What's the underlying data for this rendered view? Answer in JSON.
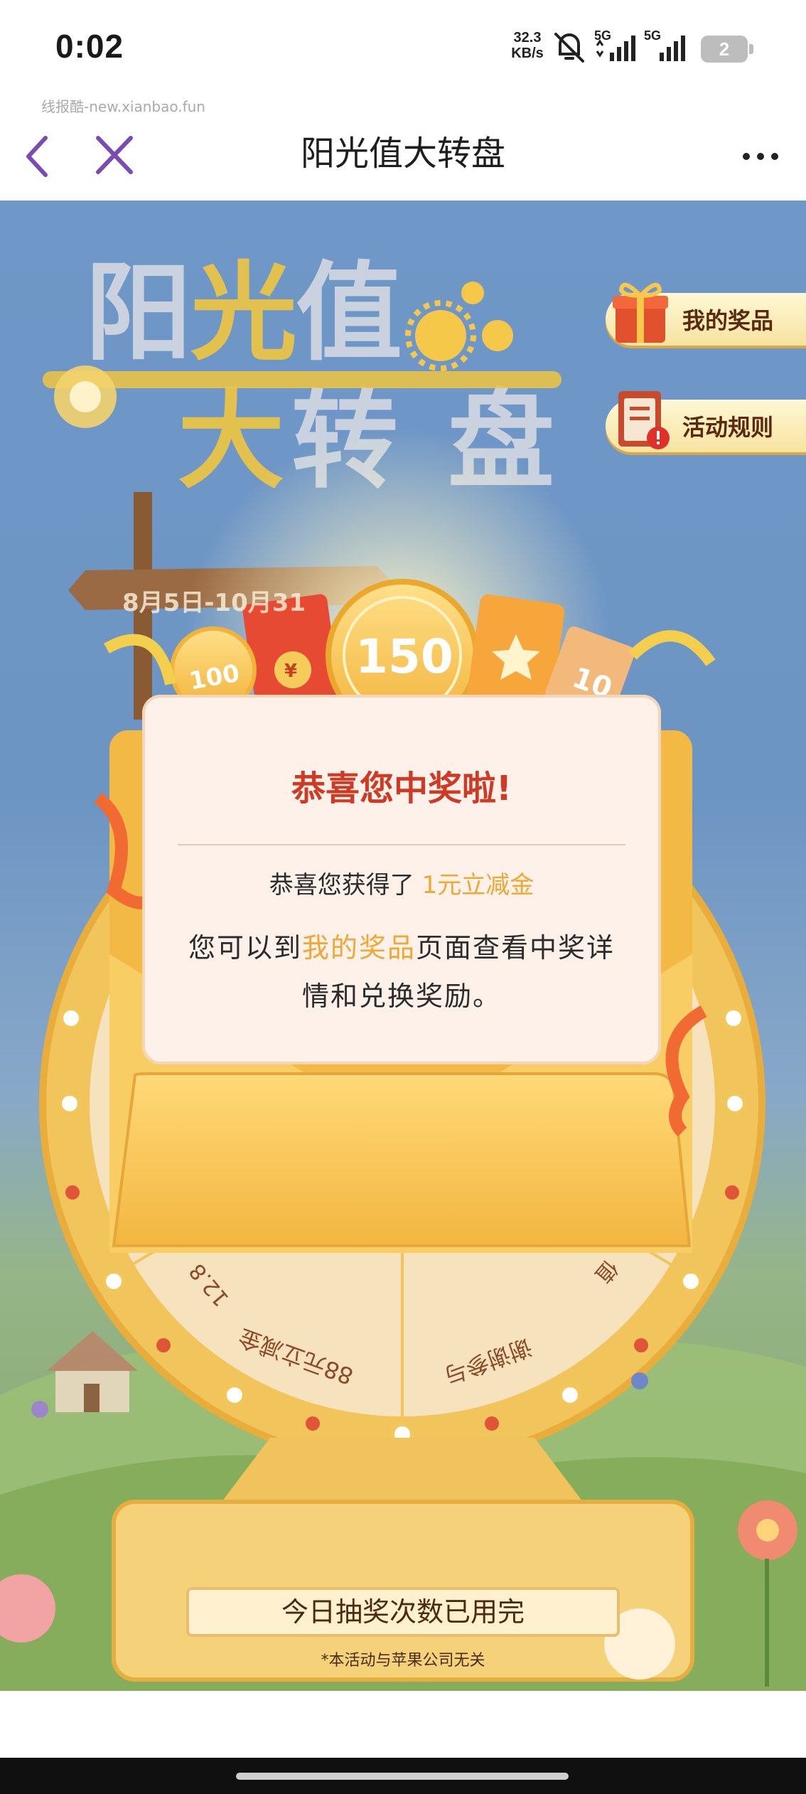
{
  "status_bar": {
    "time": "0:02",
    "net_speed_value": "32.3",
    "net_speed_unit": "KB/s",
    "signal_1": "5G",
    "signal_2": "5G",
    "battery": "2",
    "icons": [
      "mute-vibrate-icon",
      "signal-5g-icon",
      "signal-5g-icon",
      "battery-icon"
    ]
  },
  "watermark": "线报酷-new.xianbao.fun",
  "navbar": {
    "title": "阳光值大转盘",
    "icons": [
      "back-chevron-icon",
      "close-x-icon",
      "more-dots-icon"
    ],
    "accent": "#7b4bb3"
  },
  "header": {
    "logo_text": "阳光值大转盘",
    "date_range": "8月5日-10月31"
  },
  "side_buttons": {
    "my_prizes": "我的奖品",
    "rules": "活动规则"
  },
  "prize_art": {
    "coin_small": "100",
    "coin_big": "150",
    "ticket": "10",
    "red_packet": "¥"
  },
  "modal": {
    "title": "恭喜您中奖啦!",
    "line1_prefix": "恭喜您获得了 ",
    "prize_name": "1元立减金",
    "line2_prefix": "您可以到",
    "line2_link": "我的奖品",
    "line2_suffix": "页面查看中奖详情和兑换奖励。"
  },
  "wheel": {
    "segments": [
      "88元立减金",
      "谢谢参与",
      "12.8",
      "值"
    ]
  },
  "bottom": {
    "quota_text": "今日抽奖次数已用完",
    "disclaimer": "*本活动与苹果公司无关"
  },
  "colors": {
    "sky": "#6f97c7",
    "gold": "#f6c34a",
    "highlight": "#f0a834",
    "title_red": "#cf3a25"
  }
}
